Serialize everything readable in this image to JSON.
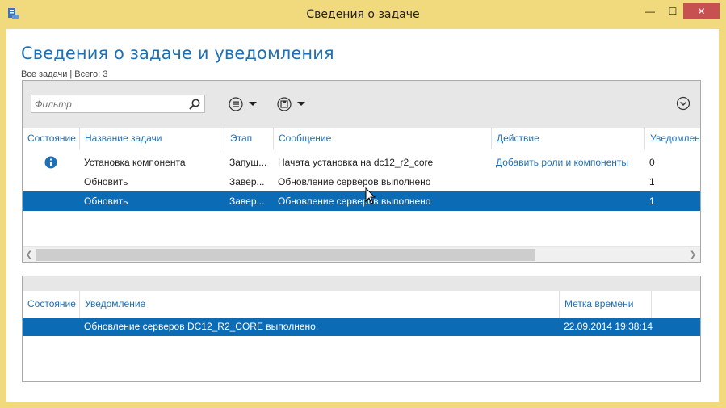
{
  "window": {
    "title": "Сведения о задаче",
    "min_label": "—",
    "max_label": "☐",
    "close_label": "✕"
  },
  "page": {
    "heading": "Сведения о задаче и уведомления",
    "subheading": "Все задачи | Всего: 3"
  },
  "filter": {
    "placeholder": "Фильтр"
  },
  "tasks": {
    "columns": [
      "Состояние",
      "Название задачи",
      "Этап",
      "Сообщение",
      "Действие",
      "Уведомления"
    ],
    "rows": [
      {
        "status_icon": "info-icon",
        "name": "Установка компонента",
        "stage": "Запущ...",
        "message": "Начата установка на dc12_r2_core",
        "action": "Добавить роли и компоненты",
        "count": "0",
        "selected": false
      },
      {
        "status_icon": "",
        "name": "Обновить",
        "stage": "Завер...",
        "message": "Обновление серверов выполнено",
        "action": "",
        "count": "1",
        "selected": false
      },
      {
        "status_icon": "",
        "name": "Обновить",
        "stage": "Завер...",
        "message": "Обновление серверов выполнено",
        "action": "",
        "count": "1",
        "selected": true
      }
    ]
  },
  "notifications": {
    "columns": [
      "Состояние",
      "Уведомление",
      "Метка времени"
    ],
    "rows": [
      {
        "message": "Обновление серверов DC12_R2_CORE выполнено.",
        "timestamp": "22.09.2014 19:38:14",
        "selected": true
      }
    ]
  },
  "colors": {
    "accent": "#1f6fb4",
    "selection": "#0c6bb5",
    "frame": "#f1d97e",
    "close_button": "#c75050"
  }
}
